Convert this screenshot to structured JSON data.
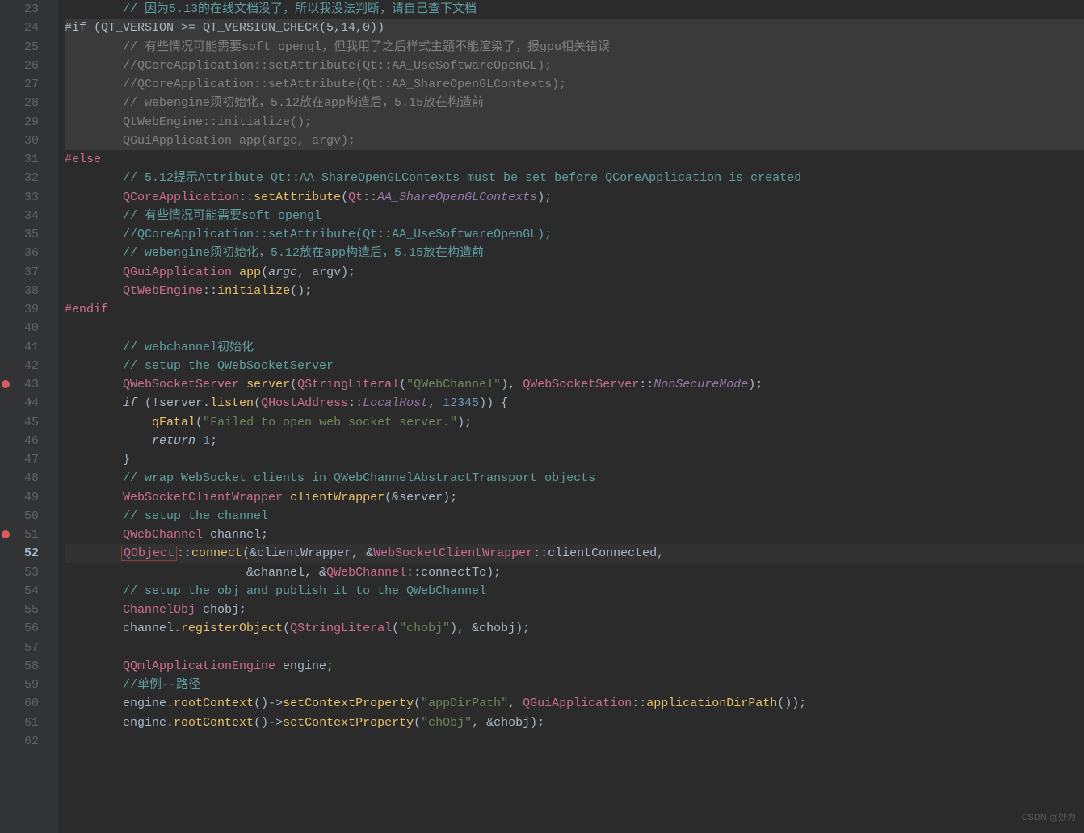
{
  "startLine": 23,
  "endLine": 62,
  "currentLine": 52,
  "breakpoints": [
    43,
    51
  ],
  "foldLines": [
    44
  ],
  "highlightedLines": [
    24,
    25,
    26,
    27,
    28,
    29,
    30
  ],
  "watermark": "CSDN @妙为",
  "lines": {
    "23": [
      {
        "t": "        ",
        "c": ""
      },
      {
        "t": "// 因为5.13的在线文档没了，所以我没法判断，请自己查下文档",
        "c": "green-comment"
      }
    ],
    "24": [
      {
        "t": "#if (QT_VERSION >= QT_VERSION_CHECK(5,14,0))",
        "c": "op"
      }
    ],
    "25": [
      {
        "t": "        ",
        "c": ""
      },
      {
        "t": "// 有些情况可能需要soft opengl，但我用了之后样式主题不能渲染了，报gpu相关错误",
        "c": "comment"
      }
    ],
    "26": [
      {
        "t": "        ",
        "c": ""
      },
      {
        "t": "//QCoreApplication::setAttribute(Qt::AA_UseSoftwareOpenGL);",
        "c": "comment"
      }
    ],
    "27": [
      {
        "t": "        ",
        "c": ""
      },
      {
        "t": "//QCoreApplication::setAttribute(Qt::AA_ShareOpenGLContexts);",
        "c": "comment"
      }
    ],
    "28": [
      {
        "t": "        ",
        "c": ""
      },
      {
        "t": "// webengine须初始化，5.12放在app构造后，5.15放在构造前",
        "c": "comment"
      }
    ],
    "29": [
      {
        "t": "        ",
        "c": ""
      },
      {
        "t": "QtWebEngine::initialize();",
        "c": "comment"
      }
    ],
    "30": [
      {
        "t": "        ",
        "c": ""
      },
      {
        "t": "QGuiApplication app(argc, argv);",
        "c": "comment"
      }
    ],
    "31": [
      {
        "t": "#else",
        "c": "pink"
      }
    ],
    "32": [
      {
        "t": "        ",
        "c": ""
      },
      {
        "t": "// 5.12提示Attribute Qt::AA_ShareOpenGLContexts must be set before QCoreApplication is created",
        "c": "green-comment"
      }
    ],
    "33": [
      {
        "t": "        ",
        "c": ""
      },
      {
        "t": "QCoreApplication",
        "c": "pink"
      },
      {
        "t": "::",
        "c": "op"
      },
      {
        "t": "setAttribute",
        "c": "func"
      },
      {
        "t": "(",
        "c": "op"
      },
      {
        "t": "Qt",
        "c": "pink"
      },
      {
        "t": "::",
        "c": "op"
      },
      {
        "t": "AA_ShareOpenGLContexts",
        "c": "const"
      },
      {
        "t": ");",
        "c": "op"
      }
    ],
    "34": [
      {
        "t": "        ",
        "c": ""
      },
      {
        "t": "// 有些情况可能需要soft opengl",
        "c": "green-comment"
      }
    ],
    "35": [
      {
        "t": "        ",
        "c": ""
      },
      {
        "t": "//QCoreApplication::setAttribute(Qt::AA_UseSoftwareOpenGL);",
        "c": "green-comment"
      }
    ],
    "36": [
      {
        "t": "        ",
        "c": ""
      },
      {
        "t": "// webengine须初始化，5.12放在app构造后，5.15放在构造前",
        "c": "green-comment"
      }
    ],
    "37": [
      {
        "t": "        ",
        "c": ""
      },
      {
        "t": "QGuiApplication",
        "c": "pink"
      },
      {
        "t": " ",
        "c": ""
      },
      {
        "t": "app",
        "c": "func"
      },
      {
        "t": "(",
        "c": "op"
      },
      {
        "t": "argc",
        "c": "param"
      },
      {
        "t": ", argv);",
        "c": "op"
      }
    ],
    "38": [
      {
        "t": "        ",
        "c": ""
      },
      {
        "t": "QtWebEngine",
        "c": "pink"
      },
      {
        "t": "::",
        "c": "op"
      },
      {
        "t": "initialize",
        "c": "func"
      },
      {
        "t": "();",
        "c": "op"
      }
    ],
    "39": [
      {
        "t": "#endif",
        "c": "pink"
      }
    ],
    "40": [
      {
        "t": "",
        "c": ""
      }
    ],
    "41": [
      {
        "t": "        ",
        "c": ""
      },
      {
        "t": "// webchannel初始化",
        "c": "green-comment"
      }
    ],
    "42": [
      {
        "t": "        ",
        "c": ""
      },
      {
        "t": "// setup the QWebSocketServer",
        "c": "green-comment"
      }
    ],
    "43": [
      {
        "t": "        ",
        "c": ""
      },
      {
        "t": "QWebSocketServer",
        "c": "pink"
      },
      {
        "t": " ",
        "c": ""
      },
      {
        "t": "server",
        "c": "func"
      },
      {
        "t": "(",
        "c": "op"
      },
      {
        "t": "QStringLiteral",
        "c": "pink"
      },
      {
        "t": "(",
        "c": "op"
      },
      {
        "t": "\"QWebChannel\"",
        "c": "string"
      },
      {
        "t": "), ",
        "c": "op"
      },
      {
        "t": "QWebSocketServer",
        "c": "pink"
      },
      {
        "t": "::",
        "c": "op"
      },
      {
        "t": "NonSecureMode",
        "c": "const"
      },
      {
        "t": ");",
        "c": "op"
      }
    ],
    "44": [
      {
        "t": "        ",
        "c": ""
      },
      {
        "t": "if",
        "c": "param"
      },
      {
        "t": " (!server.",
        "c": "op"
      },
      {
        "t": "listen",
        "c": "func"
      },
      {
        "t": "(",
        "c": "op"
      },
      {
        "t": "QHostAddress",
        "c": "pink"
      },
      {
        "t": "::",
        "c": "op"
      },
      {
        "t": "LocalHost",
        "c": "const"
      },
      {
        "t": ", ",
        "c": "op"
      },
      {
        "t": "12345",
        "c": "number"
      },
      {
        "t": ")) {",
        "c": "op"
      }
    ],
    "45": [
      {
        "t": "            ",
        "c": ""
      },
      {
        "t": "qFatal",
        "c": "func"
      },
      {
        "t": "(",
        "c": "op"
      },
      {
        "t": "\"Failed to open web socket server.\"",
        "c": "string"
      },
      {
        "t": ");",
        "c": "op"
      }
    ],
    "46": [
      {
        "t": "            ",
        "c": ""
      },
      {
        "t": "return",
        "c": "param"
      },
      {
        "t": " ",
        "c": ""
      },
      {
        "t": "1",
        "c": "number"
      },
      {
        "t": ";",
        "c": "op"
      }
    ],
    "47": [
      {
        "t": "        }",
        "c": "op"
      }
    ],
    "48": [
      {
        "t": "        ",
        "c": ""
      },
      {
        "t": "// wrap WebSocket clients in QWebChannelAbstractTransport objects",
        "c": "green-comment"
      }
    ],
    "49": [
      {
        "t": "        ",
        "c": ""
      },
      {
        "t": "WebSocketClientWrapper",
        "c": "pink"
      },
      {
        "t": " ",
        "c": ""
      },
      {
        "t": "clientWrapper",
        "c": "func"
      },
      {
        "t": "(&server);",
        "c": "op"
      }
    ],
    "50": [
      {
        "t": "        ",
        "c": ""
      },
      {
        "t": "// setup the channel",
        "c": "green-comment"
      }
    ],
    "51": [
      {
        "t": "        ",
        "c": ""
      },
      {
        "t": "QWebChannel",
        "c": "pink"
      },
      {
        "t": " channel;",
        "c": "op"
      }
    ],
    "52": [
      {
        "t": "        ",
        "c": ""
      },
      {
        "t": "QObject",
        "c": "pink boxed"
      },
      {
        "t": "::",
        "c": "op"
      },
      {
        "t": "connect",
        "c": "func"
      },
      {
        "t": "(&clientWrapper, &",
        "c": "op"
      },
      {
        "t": "WebSocketClientWrapper",
        "c": "pink"
      },
      {
        "t": "::clientConnected,",
        "c": "op"
      }
    ],
    "53": [
      {
        "t": "                         &channel, &",
        "c": "op"
      },
      {
        "t": "QWebChannel",
        "c": "pink"
      },
      {
        "t": "::connectTo);",
        "c": "op"
      }
    ],
    "54": [
      {
        "t": "        ",
        "c": ""
      },
      {
        "t": "// setup the obj and publish it to the QWebChannel",
        "c": "green-comment"
      }
    ],
    "55": [
      {
        "t": "        ",
        "c": ""
      },
      {
        "t": "ChannelObj",
        "c": "pink"
      },
      {
        "t": " chobj;",
        "c": "op"
      }
    ],
    "56": [
      {
        "t": "        channel.",
        "c": "op"
      },
      {
        "t": "registerObject",
        "c": "func"
      },
      {
        "t": "(",
        "c": "op"
      },
      {
        "t": "QStringLiteral",
        "c": "pink"
      },
      {
        "t": "(",
        "c": "op"
      },
      {
        "t": "\"chobj\"",
        "c": "string"
      },
      {
        "t": "), &chobj);",
        "c": "op"
      }
    ],
    "57": [
      {
        "t": "",
        "c": ""
      }
    ],
    "58": [
      {
        "t": "        ",
        "c": ""
      },
      {
        "t": "QQmlApplicationEngine",
        "c": "pink"
      },
      {
        "t": " engine;",
        "c": "op"
      }
    ],
    "59": [
      {
        "t": "        ",
        "c": ""
      },
      {
        "t": "//单例--路径",
        "c": "green-comment"
      }
    ],
    "60": [
      {
        "t": "        engine.",
        "c": "op"
      },
      {
        "t": "rootContext",
        "c": "func"
      },
      {
        "t": "()->",
        "c": "op"
      },
      {
        "t": "setContextProperty",
        "c": "func"
      },
      {
        "t": "(",
        "c": "op"
      },
      {
        "t": "\"appDirPath\"",
        "c": "string"
      },
      {
        "t": ", ",
        "c": "op"
      },
      {
        "t": "QGuiApplication",
        "c": "pink"
      },
      {
        "t": "::",
        "c": "op"
      },
      {
        "t": "applicationDirPath",
        "c": "func"
      },
      {
        "t": "());",
        "c": "op"
      }
    ],
    "61": [
      {
        "t": "        engine.",
        "c": "op"
      },
      {
        "t": "rootContext",
        "c": "func"
      },
      {
        "t": "()->",
        "c": "op"
      },
      {
        "t": "setContextProperty",
        "c": "func"
      },
      {
        "t": "(",
        "c": "op"
      },
      {
        "t": "\"chObj\"",
        "c": "string"
      },
      {
        "t": ", &chobj);",
        "c": "op"
      }
    ],
    "62": [
      {
        "t": "",
        "c": ""
      }
    ]
  }
}
